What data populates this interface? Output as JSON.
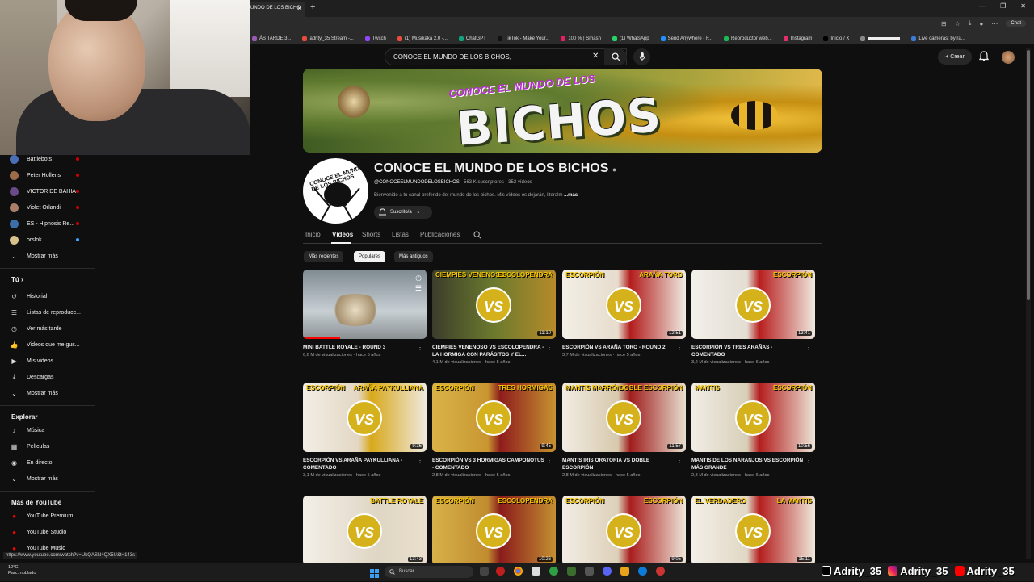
{
  "browser": {
    "active_tab": "UNDO DE LOS BICHO",
    "bookmarks": [
      "ÁS TARDE 3...",
      "adrity_35 Stream -...",
      "Twitch",
      "(1) Musikaka 2.0 -...",
      "ChatGPT",
      "TikTok - Make Your...",
      "100 % | Smash",
      "(1) WhatsApp",
      "Send Anywhere - F...",
      "Reproductor web...",
      "Instagram",
      "Inicio / X",
      "",
      "Live cameras: by ra..."
    ],
    "chat_label": "Chat",
    "status_url": "https://www.youtube.com/watch?v=UkQASN4QX5U&t=143s"
  },
  "topbar": {
    "search_value": "CONOCE EL MUNDO DE LOS BICHOS,",
    "create_label": "Crear"
  },
  "sidebar": {
    "subs": [
      {
        "label": "Battlebots",
        "color": "#4a6fb5"
      },
      {
        "label": "Peter Hollens",
        "color": "#9b6b4a"
      },
      {
        "label": "VICTOR DE BAHIA",
        "color": "#6b4a8a"
      },
      {
        "label": "Violet Orlandi",
        "color": "#a97f6a"
      },
      {
        "label": "ES - Hipnosis Re...",
        "color": "#3d6ea8"
      },
      {
        "label": "orslok",
        "color": "#d6c28a"
      }
    ],
    "show_more": "Mostrar más",
    "you_header": "Tú",
    "you_items": [
      "Historial",
      "Listas de reproducc...",
      "Ver más tarde",
      "Videos que me gus...",
      "Mis videos",
      "Descargas",
      "Mostrar más"
    ],
    "explore_header": "Explorar",
    "explore_items": [
      "Música",
      "Películas",
      "En directo",
      "Mostrar más"
    ],
    "more_header": "Más de YouTube",
    "more_items": [
      "YouTube Premium",
      "YouTube Studio",
      "YouTube Music"
    ]
  },
  "channel": {
    "banner_subtitle": "CONOCE EL MUNDO DE LOS",
    "banner_title": "BICHOS",
    "avatar_text": "CONOCE EL MUNDO DE LOS BICHOS",
    "name": "CONOCE EL MUNDO DE LOS BICHOS",
    "handle": "@CONOCEELMUNDODELOSBICHOS",
    "subscribers": "563 K suscriptores",
    "videos_count": "352 vídeos",
    "description": "Bienvenido a tu canal preferido del mundo de los bichos. Mis vídeos os dejarán, literalm",
    "more": "...más",
    "subscribed_label": "Suscrito/a"
  },
  "tabs": [
    "Inicio",
    "Vídeos",
    "Shorts",
    "Listas",
    "Publicaciones"
  ],
  "active_tab": "Vídeos",
  "chips": [
    "Más recientes",
    "Populares",
    "Más antiguos"
  ],
  "active_chip": "Populares",
  "videos": [
    {
      "title": "MINI BATTLE ROYALE - ROUND 3",
      "views": "6,6 M de visualizaciones",
      "age": "hace 5 años",
      "duration": "",
      "t1": "",
      "t2": "",
      "bg": "linear-gradient(180deg,#7f8a92,#c7cfd3 60%,#8a8f92)"
    },
    {
      "title": "CIEMPIÉS VENENOSO VS ESCOLOPENDRA - LA HORMIGA CON PARÁSITOS Y EL...",
      "views": "4,1 M de visualizaciones",
      "age": "hace 5 años",
      "duration": "11:10",
      "t1": "CIEMPIÉS VENENOSO",
      "t2": "ESCOLOPENDRA",
      "bg": "linear-gradient(90deg,#3c3d2c,#6b7a2d 50%,#b68a2a)"
    },
    {
      "title": "ESCORPIÓN VS ARAÑA TORO - ROUND 2",
      "views": "3,7 M de visualizaciones",
      "age": "hace 5 años",
      "duration": "12:51",
      "t1": "ESCORPIÓN",
      "t2": "ARAÑA TORO",
      "bg": "linear-gradient(90deg,#f2efe6,#e7dccd 45%,#b21d1d 55%,#f0ebe2)"
    },
    {
      "title": "ESCORPIÓN VS TRES ARAÑAS - COMENTADO",
      "views": "3,2 M de visualizaciones",
      "age": "hace 6 años",
      "duration": "13:41",
      "t1": "",
      "t2": "ESCORPIÓN",
      "bg": "linear-gradient(90deg,#f3f0ea,#e3ddd2 45%,#b81f1f 55%,#efe9df)"
    },
    {
      "title": "ESCORPIÓN VS ARAÑA PAYKULLIANA - COMENTADO",
      "views": "3,1 M de visualizaciones",
      "age": "hace 5 años",
      "duration": "9:36",
      "t1": "ESCORPIÓN",
      "t2": "ARAÑA PAYKULLIANA",
      "bg": "linear-gradient(90deg,#f2eee6,#e3d7c3 45%,#d8a81b 55%,#efe9df)"
    },
    {
      "title": "ESCORPIÓN VS 3 HORMIGAS CAMPONOTUS - COMENTADO",
      "views": "2,8 M de visualizaciones",
      "age": "hace 5 años",
      "duration": "9:45",
      "t1": "ESCORPIÓN",
      "t2": "TRES HORMIGAS",
      "bg": "linear-gradient(90deg,#d9b348,#c99631 45%,#8e1c1c 55%,#c79330)"
    },
    {
      "title": "MANTIS IRIS ORATORIA VS DOBLE ESCORPIÓN",
      "views": "2,8 M de visualizaciones",
      "age": "hace 5 años",
      "duration": "11:57",
      "t1": "MANTIS MARRÓN",
      "t2": "DOBLE ESCORPIÓN",
      "bg": "linear-gradient(90deg,#f1ece3,#d7c9ad 45%,#9f1d1d 55%,#e8dfcf)"
    },
    {
      "title": "MANTIS DE LOS NARANJOS VS ESCORPIÓN MÁS GRANDE",
      "views": "2,8 M de visualizaciones",
      "age": "hace 6 años",
      "duration": "10:56",
      "t1": "MANTIS",
      "t2": "ESCORPIÓN",
      "bg": "linear-gradient(90deg,#f1ede6,#d8cfb8 45%,#b31e1e 55%,#ece5d8)"
    },
    {
      "title": "",
      "views": "",
      "age": "",
      "duration": "13:43",
      "t1": "",
      "t2": "BATTLE ROYALE",
      "bg": "linear-gradient(90deg,#f3efe8,#e0d6c4 60%,#e9dfcc)"
    },
    {
      "title": "",
      "views": "",
      "age": "",
      "duration": "10:26",
      "t1": "ESCORPIÓN",
      "t2": "ESCOLOPENDRA",
      "bg": "linear-gradient(90deg,#d8b14a,#c08c2f 45%,#8a1b1b 55%,#c48f31)"
    },
    {
      "title": "",
      "views": "",
      "age": "",
      "duration": "9:05",
      "t1": "ESCORPIÓN",
      "t2": "ESCORPIÓN",
      "bg": "linear-gradient(90deg,#f2ede4,#ddd0b8 45%,#a91d1d 55%,#eee6d8)"
    },
    {
      "title": "",
      "views": "",
      "age": "",
      "duration": "15:11",
      "t1": "EL VERDADERO",
      "t2": "LA MANTIS",
      "bg": "linear-gradient(90deg,#f3efe7,#e1d7c5 45%,#b41e1e 55%,#efe8db)"
    }
  ],
  "taskbar": {
    "temperature": "12°C",
    "weather": "Parc. nublado",
    "search": "Buscar",
    "socials": [
      "Adrity_35",
      "Adrity_35",
      "Adrity_35"
    ]
  },
  "colors": {
    "accent_red": "#ff0000",
    "bg": "#0f0f0f"
  }
}
